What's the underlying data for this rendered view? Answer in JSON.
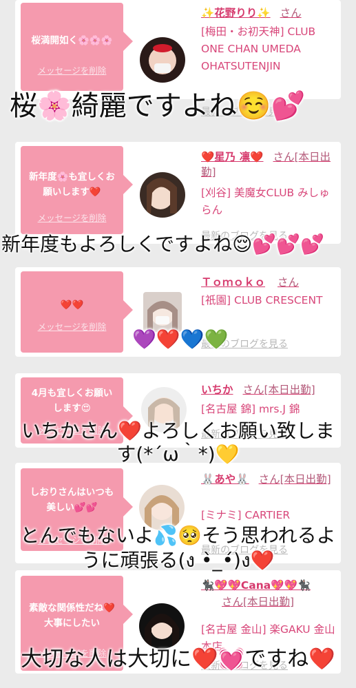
{
  "cards": [
    {
      "message": "桜満開如く🌸🌸🌸",
      "delete_label": "メッセージを削除",
      "name": "✨花野りり✨",
      "honorific": "さん",
      "info": "[梅田・お初天神] CLUB ONE CHAN UMEDA OHATSUTENJIN",
      "blog_label": "最新のブログを見る"
    },
    {
      "message": "新年度🌸も宜しくお願いします❤️",
      "delete_label": "メッセージを削除",
      "name": "❤️星乃 凛❤️",
      "honorific": "さん[本日出勤]",
      "info": "[刈谷] 美魔女CLUB みしゅらん",
      "blog_label": "最新のブログを見る"
    },
    {
      "message": "❤️❤️",
      "delete_label": "メッセージを削除",
      "name": "Ｔｏｍｏｋｏ",
      "honorific": "さん",
      "info": "[祇園] CLUB CRESCENT",
      "blog_label": "最新のブログを見る"
    },
    {
      "message": "4月も宜しくお願いします😍",
      "delete_label": "メッセージを削除",
      "name": "いちか",
      "honorific": "さん[本日出勤]",
      "info": "[名古屋 錦] mrs.J 錦",
      "blog_label": "最新のブログを見る"
    },
    {
      "message": "しおりさんはいつも美しい💕💕",
      "delete_label": "メッセージを削除",
      "name": "🐰あや🐰",
      "honorific": "さん[本日出勤]",
      "info": "[ミナミ] CARTIER",
      "blog_label": "最新のブログを見る"
    },
    {
      "message": "素敵な関係性だね❤️大事にしたい",
      "delete_label": "メッセージを削除",
      "name": "🐈‍⬛💖💖Cana💖💖🐈‍⬛",
      "honorific": "さん[本日出勤]",
      "info": "[名古屋 金山] 楽GAKU 金山本店",
      "blog_label": "最新のブログを見る"
    }
  ],
  "overlays": {
    "line1": "桜🌸綺麗ですよね☺️💕",
    "line2": "新年度もよろしくですよね😌💕💕💕",
    "hearts3": "💜❤️💙💚",
    "line4a": "いちかさん❤️よろしくお願い致しま",
    "line4b": "す(*´ω｀*)💛",
    "line5a": "とんでもないよ💦🥺そう思われるよ",
    "line5b": "うに頑張る(ง •̀_•́)ง❤️",
    "line6": "大切な人は大切に❤️💓ですね❤️"
  },
  "colors": {
    "bubble": "#f59aae",
    "name": "#d63a6d",
    "background": "#ebebeb"
  }
}
